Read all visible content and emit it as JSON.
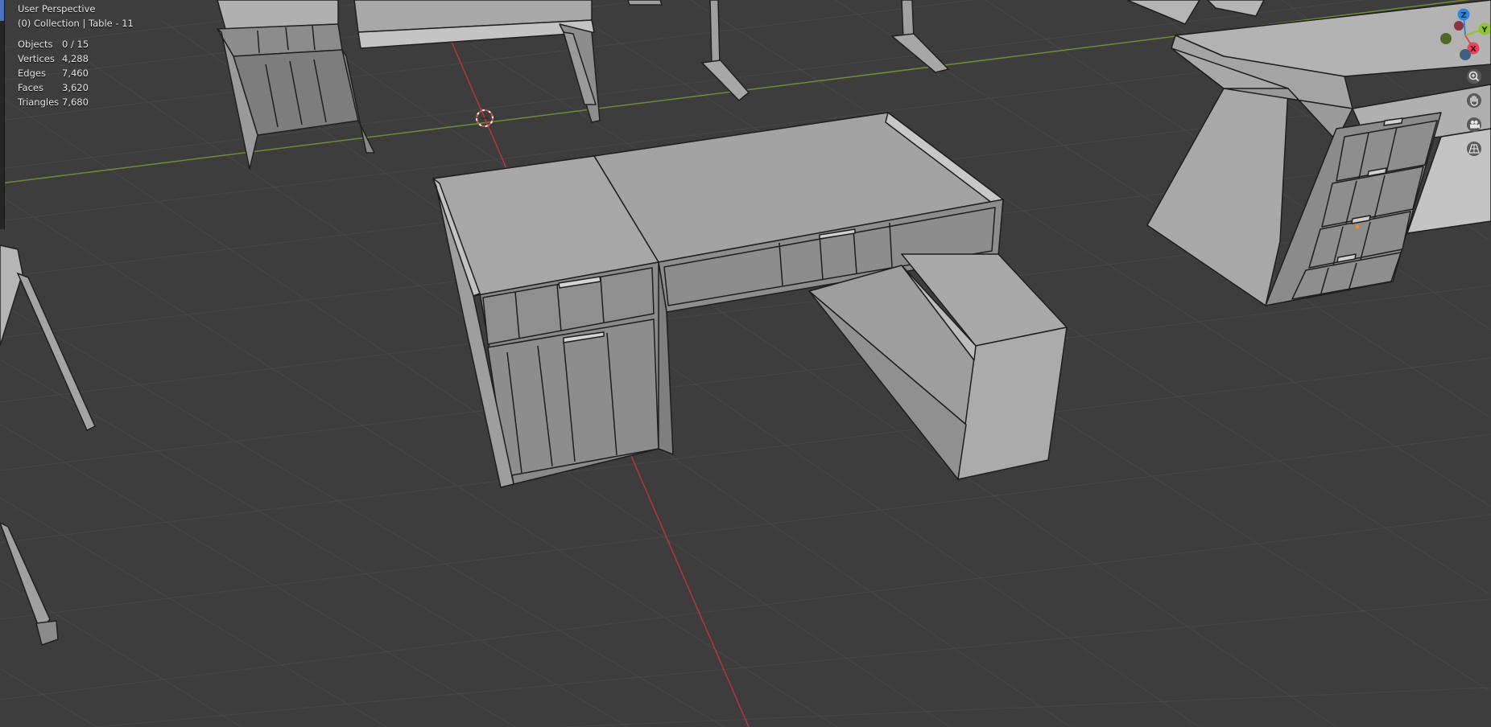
{
  "viewport": {
    "view_name": "User Perspective",
    "collection_line": "(0) Collection | Table - 11"
  },
  "stats": [
    {
      "label": "Objects",
      "value": "0 / 15"
    },
    {
      "label": "Vertices",
      "value": "4,288"
    },
    {
      "label": "Edges",
      "value": "7,460"
    },
    {
      "label": "Faces",
      "value": "3,620"
    },
    {
      "label": "Triangles",
      "value": "7,680"
    }
  ],
  "gizmo": {
    "z_label": "Z",
    "y_label": "Y",
    "x_label": "X",
    "colors": {
      "x": "#e8445a",
      "y": "#8bc72b",
      "z": "#2e88e0"
    }
  },
  "nav_tools": [
    {
      "name": "zoom-icon"
    },
    {
      "name": "pan-hand-icon"
    },
    {
      "name": "camera-icon"
    },
    {
      "name": "perspective-grid-icon"
    }
  ],
  "colors": {
    "background": "#3d3d3d",
    "grid_line": "#4a4a4a",
    "x_axis": "#b8343e",
    "y_axis": "#6e8f2b"
  }
}
